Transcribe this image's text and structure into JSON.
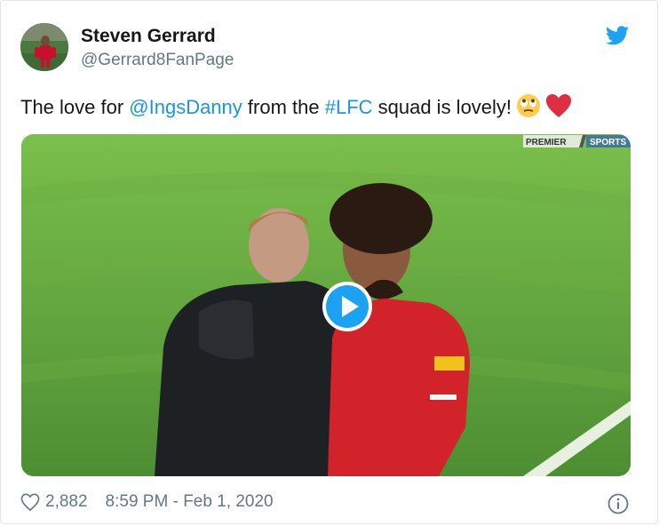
{
  "author": {
    "display_name": "Steven Gerrard",
    "handle": "@Gerrard8FanPage"
  },
  "tweet": {
    "text_before": "The love for ",
    "mention": "@IngsDanny",
    "text_middle": " from the ",
    "hashtag": "#LFC",
    "text_after": " squad is lovely!",
    "emojis": [
      "face-with-rolling-eyes-emoji",
      "red-heart-emoji"
    ]
  },
  "media": {
    "type": "video",
    "broadcaster_left": "PREMIER",
    "broadcaster_right": "SPORTS",
    "play_icon": "play-icon"
  },
  "footer": {
    "like_count": "2,882",
    "timestamp": "8:59 PM - Feb 1, 2020",
    "info_icon": "info-icon"
  },
  "colors": {
    "link": "#1b95e0",
    "twitter_blue": "#1da1f2",
    "muted_text": "#657786",
    "heart_red": "#e0245e",
    "pitch_green": "#5a9a3a"
  }
}
